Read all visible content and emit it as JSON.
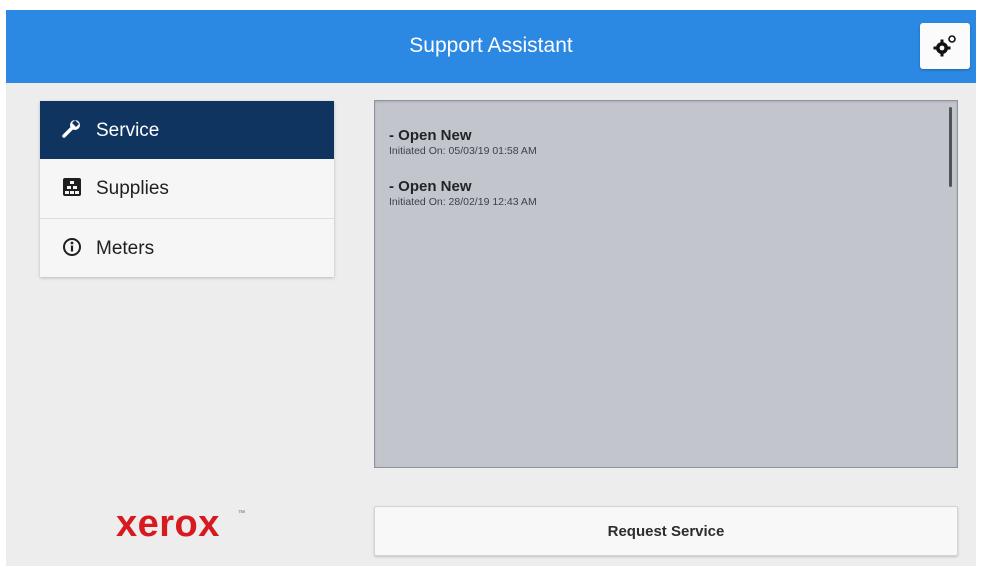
{
  "header": {
    "title": "Support Assistant",
    "settings_icon": "gear-icon",
    "background_color": "#2b88e3"
  },
  "sidebar": {
    "items": [
      {
        "label": "Service",
        "icon": "wrench-icon",
        "selected": true
      },
      {
        "label": "Supplies",
        "icon": "supplies-icon",
        "selected": false
      },
      {
        "label": "Meters",
        "icon": "info-icon",
        "selected": false
      }
    ],
    "selected_color": "#0f3460"
  },
  "service_list": {
    "items": [
      {
        "title": "- Open New",
        "subtitle": "Initiated On: 05/03/19 01:58 AM"
      },
      {
        "title": "- Open New",
        "subtitle": "Initiated On: 28/02/19 12:43 AM"
      }
    ]
  },
  "logo": {
    "text": "xerox",
    "trademark": "™",
    "color": "#d71920"
  },
  "actions": {
    "request_service": "Request Service"
  }
}
